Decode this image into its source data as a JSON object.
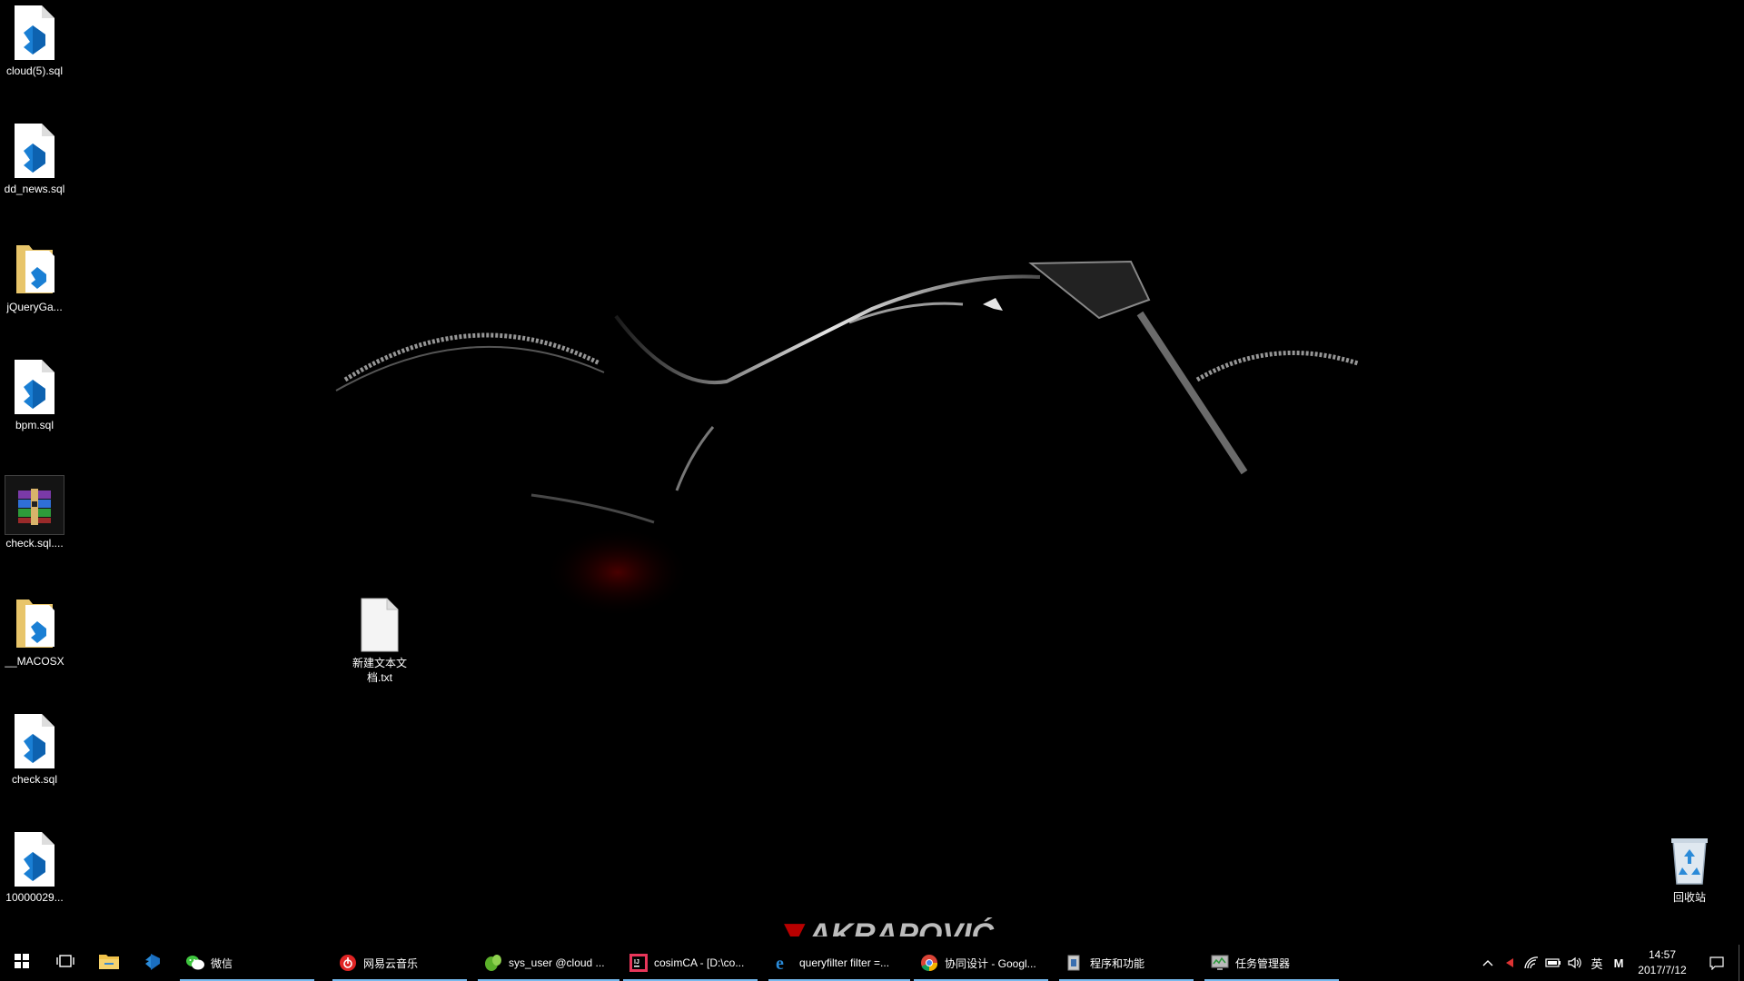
{
  "desktop": {
    "icons": [
      {
        "label": "cloud(5).sql",
        "icon": "vscode-file-icon"
      },
      {
        "label": "dd_news.sql",
        "icon": "vscode-file-icon"
      },
      {
        "label": "jQueryGa...",
        "icon": "vscode-folder-icon"
      },
      {
        "label": "bpm.sql",
        "icon": "vscode-file-icon"
      },
      {
        "label": "check.sql....",
        "icon": "winrar-archive-icon"
      },
      {
        "label": "__MACOSX",
        "icon": "vscode-folder-icon"
      },
      {
        "label": "check.sql",
        "icon": "vscode-file-icon"
      },
      {
        "label": "10000029...",
        "icon": "vscode-file-icon"
      }
    ],
    "new_text_file": {
      "label": "新建文本文档.txt",
      "icon": "text-file-icon"
    },
    "recycle_bin": {
      "label": "回收站",
      "icon": "recycle-bin-icon"
    },
    "wallpaper_brand": "AKRAPOVIĆ"
  },
  "taskbar": {
    "apps": [
      {
        "label": "微信",
        "icon": "wechat-icon"
      },
      {
        "label": "网易云音乐",
        "icon": "netease-music-icon"
      },
      {
        "label": "sys_user @cloud ...",
        "icon": "navicat-icon"
      },
      {
        "label": "cosimCA - [D:\\co...",
        "icon": "intellij-icon"
      },
      {
        "label": "queryfilter filter =...",
        "icon": "edge-icon"
      },
      {
        "label": "协同设计 - Googl...",
        "icon": "chrome-icon"
      },
      {
        "label": "程序和功能",
        "icon": "programs-features-icon"
      },
      {
        "label": "任务管理器",
        "icon": "task-manager-icon"
      }
    ],
    "tray": {
      "ime": "英",
      "ime2": "M",
      "time": "14:57",
      "date": "2017/7/12"
    },
    "colors": {
      "accent": "#76b9ed",
      "background": "#000000"
    }
  }
}
